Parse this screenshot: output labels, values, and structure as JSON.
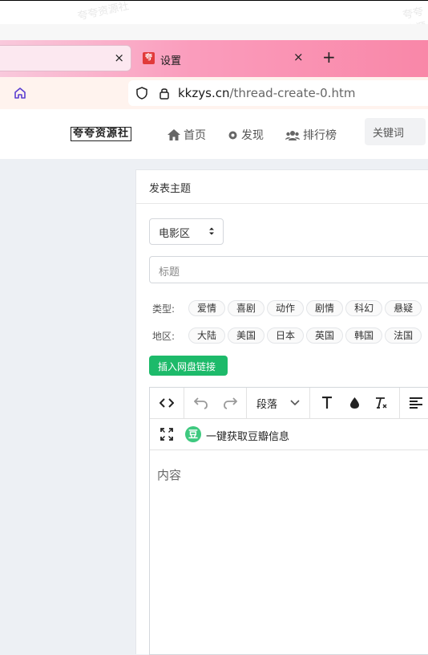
{
  "watermark": "夸夸资源社",
  "browser": {
    "inactive_tab_close": "×",
    "active_tab": {
      "favicon": "夸",
      "title": "设置",
      "close": "×"
    },
    "new_tab": "+",
    "url_domain": "kkzys.cn",
    "url_path": "/thread-create-0.htm"
  },
  "site": {
    "logo": "夸夸资源社",
    "nav": [
      {
        "label": "首页",
        "icon": "home-icon"
      },
      {
        "label": "发现",
        "icon": "gear-icon"
      },
      {
        "label": "排行榜",
        "icon": "users-icon"
      }
    ],
    "search_placeholder": "关键词"
  },
  "form": {
    "card_title": "发表主题",
    "category_select": "电影区",
    "title_placeholder": "标题",
    "type_label": "类型:",
    "types": [
      "爱情",
      "喜剧",
      "动作",
      "剧情",
      "科幻",
      "悬疑"
    ],
    "region_label": "地区:",
    "regions": [
      "大陆",
      "美国",
      "日本",
      "英国",
      "韩国",
      "法国"
    ],
    "netdisk_button": "插入网盘链接"
  },
  "editor": {
    "paragraph_select": "段落",
    "douban_badge": "豆",
    "douban_fetch": "一键获取豆瓣信息",
    "content_placeholder": "内容"
  },
  "colors": {
    "accent_green": "#1dba6a",
    "tab_gradient_end": "#f987a8",
    "url_bar_bg": "#fff3ee"
  }
}
